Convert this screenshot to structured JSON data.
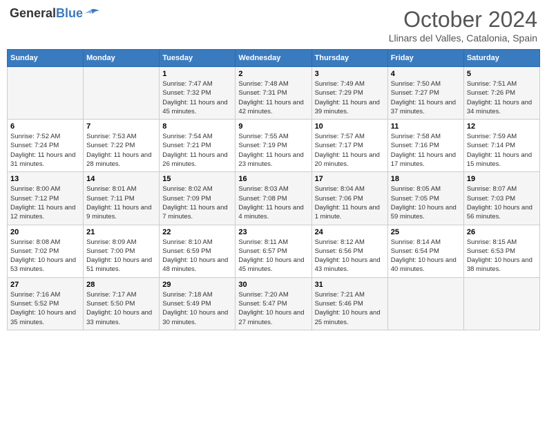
{
  "header": {
    "logo_general": "General",
    "logo_blue": "Blue",
    "month": "October 2024",
    "location": "Llinars del Valles, Catalonia, Spain"
  },
  "weekdays": [
    "Sunday",
    "Monday",
    "Tuesday",
    "Wednesday",
    "Thursday",
    "Friday",
    "Saturday"
  ],
  "weeks": [
    [
      {
        "day": "",
        "sunrise": "",
        "sunset": "",
        "daylight": ""
      },
      {
        "day": "",
        "sunrise": "",
        "sunset": "",
        "daylight": ""
      },
      {
        "day": "1",
        "sunrise": "Sunrise: 7:47 AM",
        "sunset": "Sunset: 7:32 PM",
        "daylight": "Daylight: 11 hours and 45 minutes."
      },
      {
        "day": "2",
        "sunrise": "Sunrise: 7:48 AM",
        "sunset": "Sunset: 7:31 PM",
        "daylight": "Daylight: 11 hours and 42 minutes."
      },
      {
        "day": "3",
        "sunrise": "Sunrise: 7:49 AM",
        "sunset": "Sunset: 7:29 PM",
        "daylight": "Daylight: 11 hours and 39 minutes."
      },
      {
        "day": "4",
        "sunrise": "Sunrise: 7:50 AM",
        "sunset": "Sunset: 7:27 PM",
        "daylight": "Daylight: 11 hours and 37 minutes."
      },
      {
        "day": "5",
        "sunrise": "Sunrise: 7:51 AM",
        "sunset": "Sunset: 7:26 PM",
        "daylight": "Daylight: 11 hours and 34 minutes."
      }
    ],
    [
      {
        "day": "6",
        "sunrise": "Sunrise: 7:52 AM",
        "sunset": "Sunset: 7:24 PM",
        "daylight": "Daylight: 11 hours and 31 minutes."
      },
      {
        "day": "7",
        "sunrise": "Sunrise: 7:53 AM",
        "sunset": "Sunset: 7:22 PM",
        "daylight": "Daylight: 11 hours and 28 minutes."
      },
      {
        "day": "8",
        "sunrise": "Sunrise: 7:54 AM",
        "sunset": "Sunset: 7:21 PM",
        "daylight": "Daylight: 11 hours and 26 minutes."
      },
      {
        "day": "9",
        "sunrise": "Sunrise: 7:55 AM",
        "sunset": "Sunset: 7:19 PM",
        "daylight": "Daylight: 11 hours and 23 minutes."
      },
      {
        "day": "10",
        "sunrise": "Sunrise: 7:57 AM",
        "sunset": "Sunset: 7:17 PM",
        "daylight": "Daylight: 11 hours and 20 minutes."
      },
      {
        "day": "11",
        "sunrise": "Sunrise: 7:58 AM",
        "sunset": "Sunset: 7:16 PM",
        "daylight": "Daylight: 11 hours and 17 minutes."
      },
      {
        "day": "12",
        "sunrise": "Sunrise: 7:59 AM",
        "sunset": "Sunset: 7:14 PM",
        "daylight": "Daylight: 11 hours and 15 minutes."
      }
    ],
    [
      {
        "day": "13",
        "sunrise": "Sunrise: 8:00 AM",
        "sunset": "Sunset: 7:12 PM",
        "daylight": "Daylight: 11 hours and 12 minutes."
      },
      {
        "day": "14",
        "sunrise": "Sunrise: 8:01 AM",
        "sunset": "Sunset: 7:11 PM",
        "daylight": "Daylight: 11 hours and 9 minutes."
      },
      {
        "day": "15",
        "sunrise": "Sunrise: 8:02 AM",
        "sunset": "Sunset: 7:09 PM",
        "daylight": "Daylight: 11 hours and 7 minutes."
      },
      {
        "day": "16",
        "sunrise": "Sunrise: 8:03 AM",
        "sunset": "Sunset: 7:08 PM",
        "daylight": "Daylight: 11 hours and 4 minutes."
      },
      {
        "day": "17",
        "sunrise": "Sunrise: 8:04 AM",
        "sunset": "Sunset: 7:06 PM",
        "daylight": "Daylight: 11 hours and 1 minute."
      },
      {
        "day": "18",
        "sunrise": "Sunrise: 8:05 AM",
        "sunset": "Sunset: 7:05 PM",
        "daylight": "Daylight: 10 hours and 59 minutes."
      },
      {
        "day": "19",
        "sunrise": "Sunrise: 8:07 AM",
        "sunset": "Sunset: 7:03 PM",
        "daylight": "Daylight: 10 hours and 56 minutes."
      }
    ],
    [
      {
        "day": "20",
        "sunrise": "Sunrise: 8:08 AM",
        "sunset": "Sunset: 7:02 PM",
        "daylight": "Daylight: 10 hours and 53 minutes."
      },
      {
        "day": "21",
        "sunrise": "Sunrise: 8:09 AM",
        "sunset": "Sunset: 7:00 PM",
        "daylight": "Daylight: 10 hours and 51 minutes."
      },
      {
        "day": "22",
        "sunrise": "Sunrise: 8:10 AM",
        "sunset": "Sunset: 6:59 PM",
        "daylight": "Daylight: 10 hours and 48 minutes."
      },
      {
        "day": "23",
        "sunrise": "Sunrise: 8:11 AM",
        "sunset": "Sunset: 6:57 PM",
        "daylight": "Daylight: 10 hours and 45 minutes."
      },
      {
        "day": "24",
        "sunrise": "Sunrise: 8:12 AM",
        "sunset": "Sunset: 6:56 PM",
        "daylight": "Daylight: 10 hours and 43 minutes."
      },
      {
        "day": "25",
        "sunrise": "Sunrise: 8:14 AM",
        "sunset": "Sunset: 6:54 PM",
        "daylight": "Daylight: 10 hours and 40 minutes."
      },
      {
        "day": "26",
        "sunrise": "Sunrise: 8:15 AM",
        "sunset": "Sunset: 6:53 PM",
        "daylight": "Daylight: 10 hours and 38 minutes."
      }
    ],
    [
      {
        "day": "27",
        "sunrise": "Sunrise: 7:16 AM",
        "sunset": "Sunset: 5:52 PM",
        "daylight": "Daylight: 10 hours and 35 minutes."
      },
      {
        "day": "28",
        "sunrise": "Sunrise: 7:17 AM",
        "sunset": "Sunset: 5:50 PM",
        "daylight": "Daylight: 10 hours and 33 minutes."
      },
      {
        "day": "29",
        "sunrise": "Sunrise: 7:18 AM",
        "sunset": "Sunset: 5:49 PM",
        "daylight": "Daylight: 10 hours and 30 minutes."
      },
      {
        "day": "30",
        "sunrise": "Sunrise: 7:20 AM",
        "sunset": "Sunset: 5:47 PM",
        "daylight": "Daylight: 10 hours and 27 minutes."
      },
      {
        "day": "31",
        "sunrise": "Sunrise: 7:21 AM",
        "sunset": "Sunset: 5:46 PM",
        "daylight": "Daylight: 10 hours and 25 minutes."
      },
      {
        "day": "",
        "sunrise": "",
        "sunset": "",
        "daylight": ""
      },
      {
        "day": "",
        "sunrise": "",
        "sunset": "",
        "daylight": ""
      }
    ]
  ]
}
